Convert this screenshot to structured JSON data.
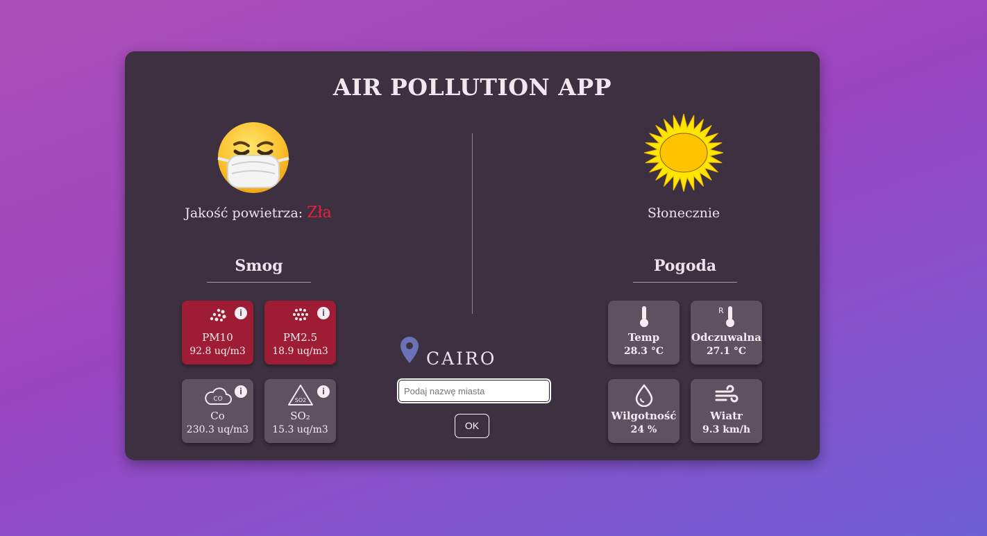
{
  "app": {
    "title": "AIR POLLUTION APP"
  },
  "air_quality": {
    "label": "Jakość powietrza:",
    "value": "Zła",
    "value_color": "#e8213a",
    "icon": "face-with-medical-mask-icon"
  },
  "weather": {
    "description": "Słonecznie",
    "icon": "sun-icon"
  },
  "smog": {
    "heading": "Smog",
    "tiles": [
      {
        "label": "PM10",
        "value": "92.8 uq/m3",
        "icon": "particles-icon",
        "status": "bad"
      },
      {
        "label": "PM2.5",
        "value": "18.9 uq/m3",
        "icon": "fine-particles-icon",
        "status": "bad"
      },
      {
        "label": "Co",
        "value": "230.3 uq/m3",
        "icon": "co-cloud-icon",
        "icon_text": "CO",
        "status": "ok"
      },
      {
        "label": "SO₂",
        "value": "15.3 uq/m3",
        "icon": "so2-warning-icon",
        "icon_text": "SO2",
        "status": "ok"
      }
    ],
    "info_symbol": "i"
  },
  "weather_panel": {
    "heading": "Pogoda",
    "tiles": [
      {
        "label": "Temp",
        "value": "28.3 °C",
        "icon": "thermometer-icon"
      },
      {
        "label": "Odczuwalna",
        "value": "27.1 °C",
        "icon": "feels-like-thermometer-icon",
        "icon_text": "R"
      },
      {
        "label": "Wilgotność",
        "value": "24 %",
        "icon": "humidity-drop-icon"
      },
      {
        "label": "Wiatr",
        "value": "9.3 km/h",
        "icon": "wind-icon"
      }
    ]
  },
  "location": {
    "city": "CAIRO",
    "icon": "location-pin-icon"
  },
  "search": {
    "placeholder": "Podaj nazwę miasta",
    "value": "",
    "button_label": "OK"
  },
  "colors": {
    "card": "#3d3041",
    "tile": "#5e5260",
    "tile_bad": "#9e1d35",
    "pin": "#6b72b8"
  }
}
